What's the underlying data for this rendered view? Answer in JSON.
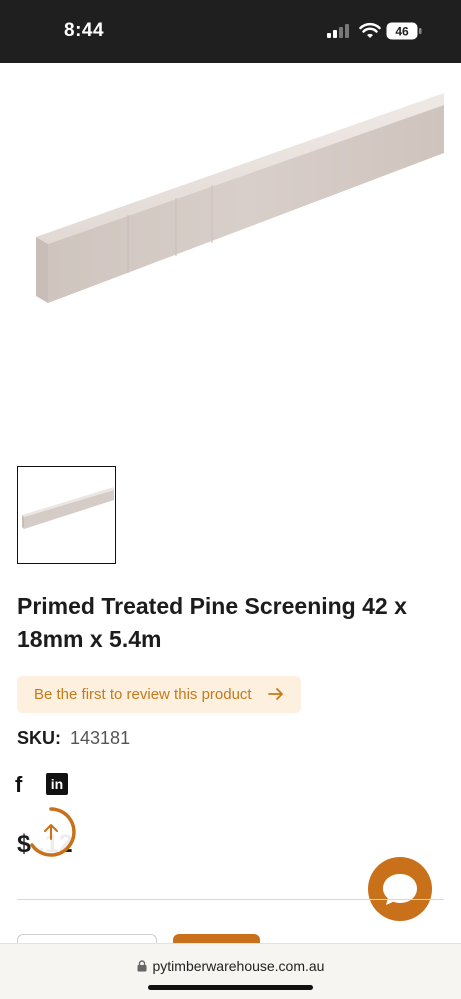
{
  "status_bar": {
    "time": "8:44",
    "battery": "46"
  },
  "product": {
    "title": "Primed Treated Pine Screening 42 x 18mm x 5.4m",
    "review_cta": "Be the first to review this product",
    "sku_label": "SKU:",
    "sku_value": "143181",
    "price": "$ .12"
  },
  "social": {
    "facebook": "f",
    "linkedin": "in"
  },
  "browser": {
    "url": "pytimberwarehouse.com.au"
  },
  "icons": {
    "review_arrow": "arrow-right-icon",
    "scroll_top": "arrow-up-icon",
    "chat": "chat-bubble-icon",
    "lock": "lock-icon"
  },
  "colors": {
    "accent": "#c8711a",
    "review_bg": "#fdf0df",
    "review_text": "#c57a1b",
    "status_bg": "#1f1f1f"
  }
}
